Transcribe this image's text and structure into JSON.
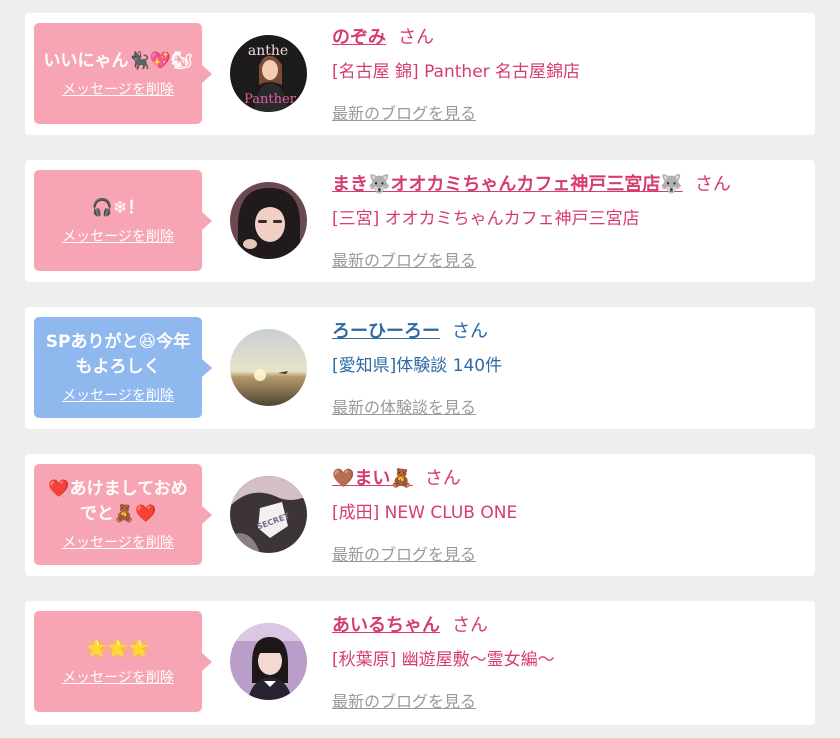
{
  "cards": [
    {
      "bubble_text": "いいにゃん🐈‍⬛💖🐿",
      "delete_label": "メッセージを削除",
      "name": "のぞみ",
      "san": "さん",
      "shop": "[名古屋 錦] Panther 名古屋錦店",
      "link": "最新のブログを見る",
      "avatar_icon": "person-photo-icon",
      "bubble_color": "#f7a5b4",
      "name_color": "#d63d6c",
      "shop_color": "#d63d6c"
    },
    {
      "bubble_text": "🎧❄！",
      "delete_label": "メッセージを削除",
      "name": "まき🐺オオカミちゃんカフェ神戸三宮店🐺",
      "san": "さん",
      "shop": "[三宮] オオカミちゃんカフェ神戸三宮店",
      "link": "最新のブログを見る",
      "avatar_icon": "person-photo-icon",
      "bubble_color": "#f7a5b4",
      "name_color": "#d63d6c",
      "shop_color": "#d63d6c"
    },
    {
      "bubble_text": "SPありがと😆今年もよろしく",
      "delete_label": "メッセージを削除",
      "name": "ろーひーろー",
      "san": "さん",
      "shop": "[愛知県]体験談 140件",
      "link": "最新の体験談を見る",
      "avatar_icon": "sunset-photo-icon",
      "bubble_color": "#8fb8ee",
      "name_color": "#2d6aa3",
      "shop_color": "#2d6aa3"
    },
    {
      "bubble_text": "❤️あけましておめでと🧸❤️",
      "delete_label": "メッセージを削除",
      "name": "🤎まい🧸",
      "san": "さん",
      "shop": "[成田] NEW CLUB ONE",
      "link": "最新のブログを見る",
      "avatar_icon": "secret-photo-icon",
      "bubble_color": "#f7a5b4",
      "name_color": "#d63d6c",
      "shop_color": "#d63d6c"
    },
    {
      "bubble_text": "🌟🌟🌟",
      "delete_label": "メッセージを削除",
      "name": "あいるちゃん",
      "san": "さん",
      "shop": "[秋葉原] 幽遊屋敷〜霊女編〜",
      "link": "最新のブログを見る",
      "avatar_icon": "person-photo-icon",
      "bubble_color": "#f7a5b4",
      "name_color": "#d63d6c",
      "shop_color": "#d63d6c"
    }
  ]
}
